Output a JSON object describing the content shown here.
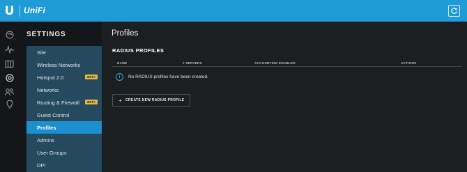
{
  "topbar": {
    "logo_glyph": "U",
    "brand": "UniFi",
    "refresh_icon": "refresh-icon"
  },
  "icon_rail": {
    "icons": [
      "dashboard-icon",
      "statistics-icon",
      "map-icon",
      "devices-icon",
      "clients-icon",
      "insights-icon"
    ]
  },
  "settings": {
    "title": "SETTINGS",
    "menu": [
      {
        "label": "Site"
      },
      {
        "label": "Wireless Networks"
      },
      {
        "label": "Hotspot 2.0",
        "badge": "BETA"
      },
      {
        "label": "Networks"
      },
      {
        "label": "Routing & Firewall",
        "badge": "BETA"
      },
      {
        "label": "Guest Control"
      },
      {
        "label": "Profiles",
        "active": true
      },
      {
        "label": "Admins"
      },
      {
        "label": "User Groups"
      },
      {
        "label": "DPI"
      }
    ]
  },
  "main": {
    "title": "Profiles",
    "section_title": "RADIUS PROFILES",
    "columns": [
      "NAME",
      "# SERVERS",
      "ACCOUNTING ENABLED",
      "ACTIONS"
    ],
    "empty_message": "No RADIUS profiles have been created.",
    "create_button": "CREATE NEW RADIUS PROFILE"
  },
  "colors": {
    "topbar": "#1f9bd7",
    "menu_bg": "#25495d",
    "menu_active": "#1d8fcf",
    "beta_badge": "#e6b84a",
    "background": "#1c1f22"
  }
}
